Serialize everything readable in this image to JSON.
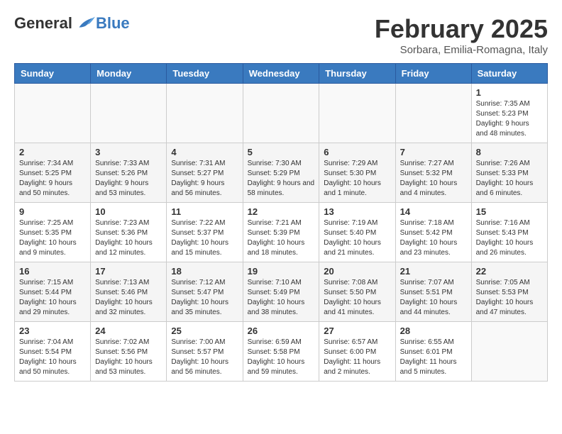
{
  "logo": {
    "text_general": "General",
    "text_blue": "Blue"
  },
  "header": {
    "month": "February 2025",
    "location": "Sorbara, Emilia-Romagna, Italy"
  },
  "days_of_week": [
    "Sunday",
    "Monday",
    "Tuesday",
    "Wednesday",
    "Thursday",
    "Friday",
    "Saturday"
  ],
  "weeks": [
    [
      {
        "num": "",
        "info": ""
      },
      {
        "num": "",
        "info": ""
      },
      {
        "num": "",
        "info": ""
      },
      {
        "num": "",
        "info": ""
      },
      {
        "num": "",
        "info": ""
      },
      {
        "num": "",
        "info": ""
      },
      {
        "num": "1",
        "info": "Sunrise: 7:35 AM\nSunset: 5:23 PM\nDaylight: 9 hours and 48 minutes."
      }
    ],
    [
      {
        "num": "2",
        "info": "Sunrise: 7:34 AM\nSunset: 5:25 PM\nDaylight: 9 hours and 50 minutes."
      },
      {
        "num": "3",
        "info": "Sunrise: 7:33 AM\nSunset: 5:26 PM\nDaylight: 9 hours and 53 minutes."
      },
      {
        "num": "4",
        "info": "Sunrise: 7:31 AM\nSunset: 5:27 PM\nDaylight: 9 hours and 56 minutes."
      },
      {
        "num": "5",
        "info": "Sunrise: 7:30 AM\nSunset: 5:29 PM\nDaylight: 9 hours and 58 minutes."
      },
      {
        "num": "6",
        "info": "Sunrise: 7:29 AM\nSunset: 5:30 PM\nDaylight: 10 hours and 1 minute."
      },
      {
        "num": "7",
        "info": "Sunrise: 7:27 AM\nSunset: 5:32 PM\nDaylight: 10 hours and 4 minutes."
      },
      {
        "num": "8",
        "info": "Sunrise: 7:26 AM\nSunset: 5:33 PM\nDaylight: 10 hours and 6 minutes."
      }
    ],
    [
      {
        "num": "9",
        "info": "Sunrise: 7:25 AM\nSunset: 5:35 PM\nDaylight: 10 hours and 9 minutes."
      },
      {
        "num": "10",
        "info": "Sunrise: 7:23 AM\nSunset: 5:36 PM\nDaylight: 10 hours and 12 minutes."
      },
      {
        "num": "11",
        "info": "Sunrise: 7:22 AM\nSunset: 5:37 PM\nDaylight: 10 hours and 15 minutes."
      },
      {
        "num": "12",
        "info": "Sunrise: 7:21 AM\nSunset: 5:39 PM\nDaylight: 10 hours and 18 minutes."
      },
      {
        "num": "13",
        "info": "Sunrise: 7:19 AM\nSunset: 5:40 PM\nDaylight: 10 hours and 21 minutes."
      },
      {
        "num": "14",
        "info": "Sunrise: 7:18 AM\nSunset: 5:42 PM\nDaylight: 10 hours and 23 minutes."
      },
      {
        "num": "15",
        "info": "Sunrise: 7:16 AM\nSunset: 5:43 PM\nDaylight: 10 hours and 26 minutes."
      }
    ],
    [
      {
        "num": "16",
        "info": "Sunrise: 7:15 AM\nSunset: 5:44 PM\nDaylight: 10 hours and 29 minutes."
      },
      {
        "num": "17",
        "info": "Sunrise: 7:13 AM\nSunset: 5:46 PM\nDaylight: 10 hours and 32 minutes."
      },
      {
        "num": "18",
        "info": "Sunrise: 7:12 AM\nSunset: 5:47 PM\nDaylight: 10 hours and 35 minutes."
      },
      {
        "num": "19",
        "info": "Sunrise: 7:10 AM\nSunset: 5:49 PM\nDaylight: 10 hours and 38 minutes."
      },
      {
        "num": "20",
        "info": "Sunrise: 7:08 AM\nSunset: 5:50 PM\nDaylight: 10 hours and 41 minutes."
      },
      {
        "num": "21",
        "info": "Sunrise: 7:07 AM\nSunset: 5:51 PM\nDaylight: 10 hours and 44 minutes."
      },
      {
        "num": "22",
        "info": "Sunrise: 7:05 AM\nSunset: 5:53 PM\nDaylight: 10 hours and 47 minutes."
      }
    ],
    [
      {
        "num": "23",
        "info": "Sunrise: 7:04 AM\nSunset: 5:54 PM\nDaylight: 10 hours and 50 minutes."
      },
      {
        "num": "24",
        "info": "Sunrise: 7:02 AM\nSunset: 5:56 PM\nDaylight: 10 hours and 53 minutes."
      },
      {
        "num": "25",
        "info": "Sunrise: 7:00 AM\nSunset: 5:57 PM\nDaylight: 10 hours and 56 minutes."
      },
      {
        "num": "26",
        "info": "Sunrise: 6:59 AM\nSunset: 5:58 PM\nDaylight: 10 hours and 59 minutes."
      },
      {
        "num": "27",
        "info": "Sunrise: 6:57 AM\nSunset: 6:00 PM\nDaylight: 11 hours and 2 minutes."
      },
      {
        "num": "28",
        "info": "Sunrise: 6:55 AM\nSunset: 6:01 PM\nDaylight: 11 hours and 5 minutes."
      },
      {
        "num": "",
        "info": ""
      }
    ]
  ]
}
